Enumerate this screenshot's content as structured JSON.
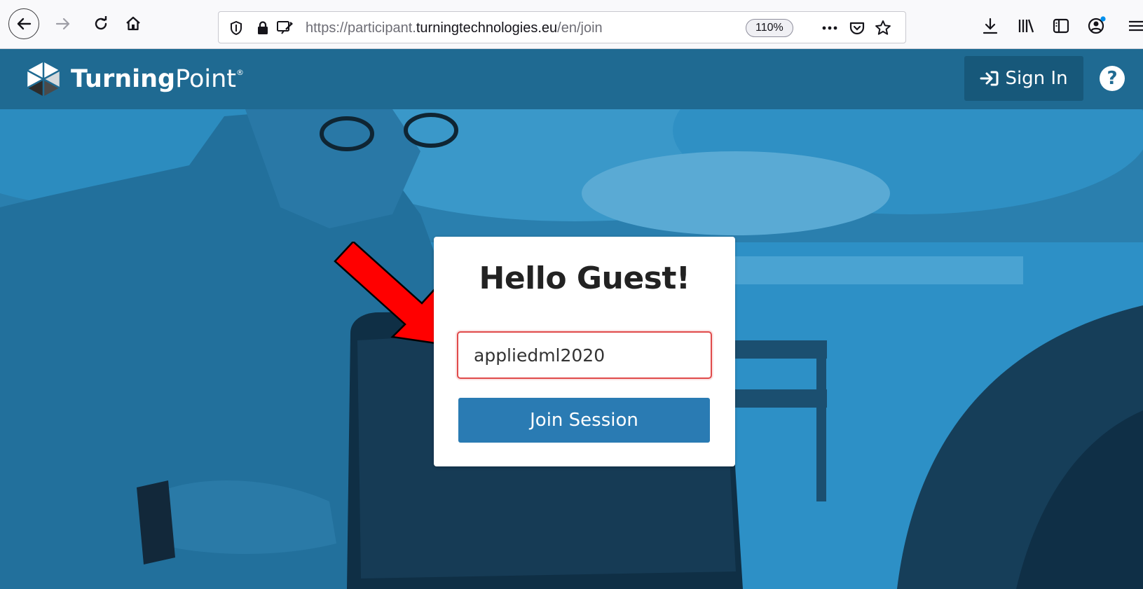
{
  "browser": {
    "url_prefix": "https://participant.",
    "url_host": "turningtechnologies.eu",
    "url_path": "/en/join",
    "zoom": "110%",
    "overflow_icon": "ellipsis-icon"
  },
  "header": {
    "brand_bold": "Turning",
    "brand_regular": "Point",
    "brand_mark": "®",
    "signin_label": "Sign In",
    "help_symbol": "?"
  },
  "card": {
    "title": "Hello Guest!",
    "session_value": "appliedml2020",
    "join_label": "Join Session"
  },
  "colors": {
    "header_bg": "#1f6a92",
    "signin_bg": "#17587a",
    "join_button": "#2a7bb3",
    "input_border": "#e04a4a",
    "annotation_arrow": "#ff0000"
  }
}
